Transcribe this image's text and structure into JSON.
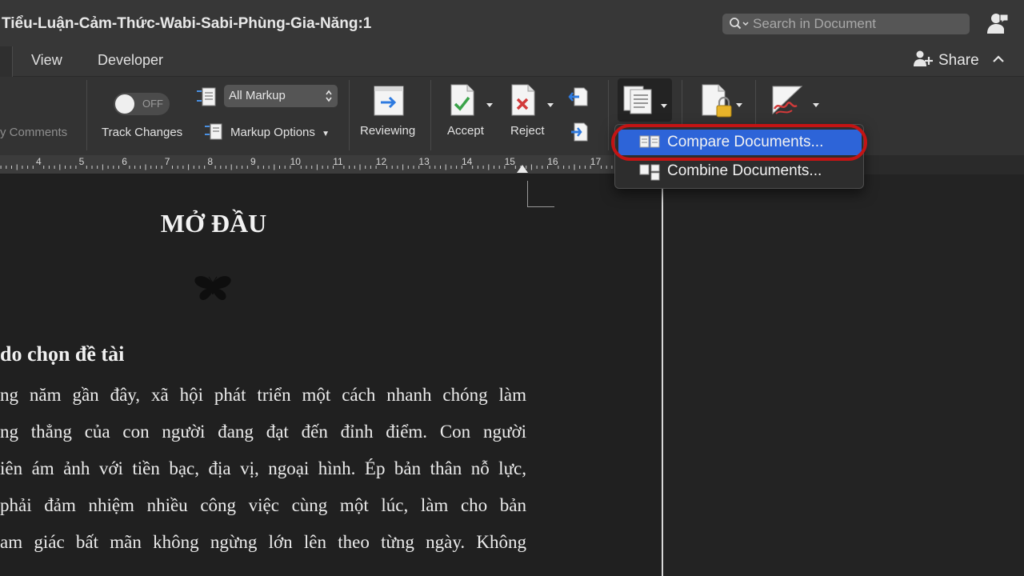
{
  "window": {
    "title": "Tiểu-Luận-Cảm-Thức-Wabi-Sabi-Phùng-Gia-Năng:1",
    "search_placeholder": "Search in Document"
  },
  "tabs": [
    {
      "label": "View"
    },
    {
      "label": "Developer"
    }
  ],
  "share_label": "Share",
  "ribbon": {
    "comments_label": "y Comments",
    "toggle_state": "OFF",
    "track_changes_label": "Track Changes",
    "markup_select_value": "All Markup",
    "markup_options_label": "Markup Options",
    "reviewing_label": "Reviewing",
    "accept_label": "Accept",
    "reject_label": "Reject"
  },
  "ruler": {
    "labels": [
      "4",
      "5",
      "6",
      "7",
      "8",
      "9",
      "10",
      "11",
      "12",
      "13",
      "14",
      "15",
      "16",
      "17"
    ]
  },
  "compare_menu": {
    "items": [
      {
        "label": "Compare Documents...",
        "selected": true
      },
      {
        "label": "Combine Documents...",
        "selected": false
      }
    ],
    "highlight_color": "#c31414",
    "selected_color": "#2d64d8"
  },
  "document": {
    "heading": "MỞ ĐẦU",
    "section_title": "do chọn đề tài",
    "lines": [
      "ng năm gần đây, xã hội phát triển một cách nhanh chóng làm",
      "ng thẳng của con người đang đạt đến đỉnh điểm. Con người",
      "iên ám ảnh với tiền bạc, địa vị, ngoại hình. Ép bản thân nỗ lực,",
      " phải đảm nhiệm nhiều công việc cùng một lúc, làm cho bản",
      "am giác bất mãn không ngừng lớn lên theo từng ngày. Không"
    ]
  }
}
